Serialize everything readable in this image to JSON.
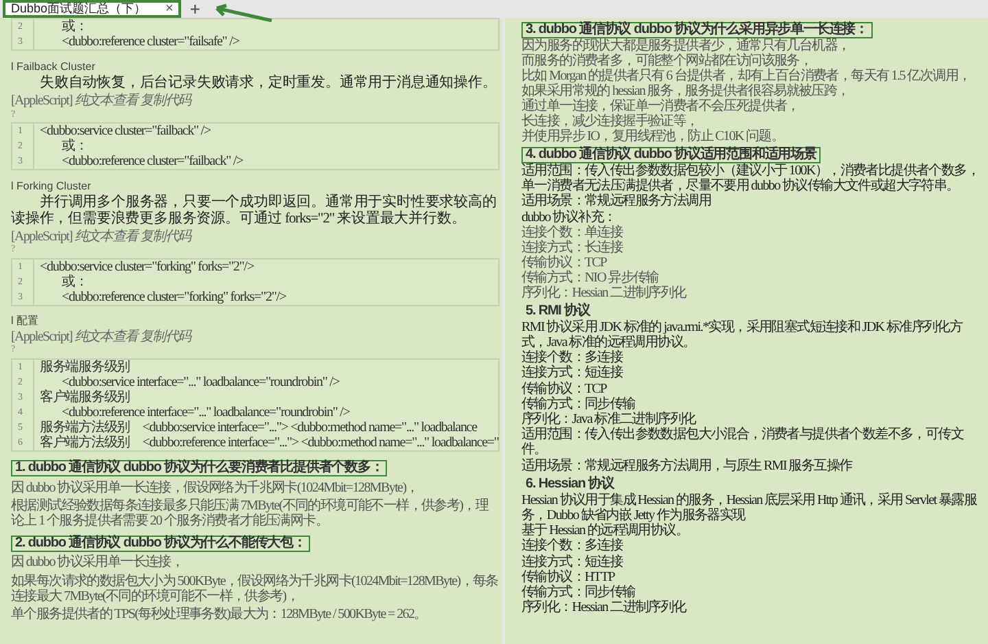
{
  "tab_bar": {
    "tab": {
      "title": "Dubbo面试题汇总（下）",
      "close": "×",
      "selected": true
    },
    "new_tab": "+"
  },
  "left_page": {
    "blocks": [
      {
        "kind": "code",
        "lines": [
          {
            "number": "2",
            "text": "或：",
            "kind": "indent"
          },
          {
            "number": "3",
            "text": "<dubbo:reference cluster=\"failsafe\" />",
            "kind": "indent"
          }
        ]
      },
      {
        "kind": "section",
        "text": "l Failback Cluster"
      },
      {
        "kind": "para",
        "text": "失败自动恢复，后台记录失败请求，定时重发。通常用于消息通知操作。"
      },
      {
        "kind": "note",
        "lang": "[AppleScript]",
        "actions": "纯文本查看 复制代码",
        "marker": "?"
      },
      {
        "kind": "code",
        "lines": [
          {
            "number": "1",
            "text": "<dubbo:service cluster=\"failback\" />",
            "kind": "plain"
          },
          {
            "number": "2",
            "text": "或：",
            "kind": "indent"
          },
          {
            "number": "3",
            "text": "<dubbo:reference cluster=\"failback\" />",
            "kind": "indent"
          }
        ]
      },
      {
        "kind": "section",
        "text": "l Forking Cluster"
      },
      {
        "kind": "para",
        "text": "并行调用多个服务器，只要一个成功即返回。通常用于实时性要求较高的读操作，但需要浪费更多服务资源。可通过 forks=\"2\" 来设置最大并行数。"
      },
      {
        "kind": "note",
        "lang": "[AppleScript]",
        "actions": "纯文本查看 复制代码",
        "marker": "?"
      },
      {
        "kind": "code",
        "lines": [
          {
            "number": "1",
            "text": "<dubbo:service cluster=\"forking\" forks=\"2\"/>",
            "kind": "plain"
          },
          {
            "number": "2",
            "text": "或：",
            "kind": "indent"
          },
          {
            "number": "3",
            "text": "<dubbo:reference cluster=\"forking\" forks=\"2\"/>",
            "kind": "indent"
          }
        ]
      },
      {
        "kind": "section",
        "text": "l 配置"
      },
      {
        "kind": "note",
        "lang": "[AppleScript]",
        "actions": "纯文本查看 复制代码",
        "marker": "?"
      },
      {
        "kind": "code",
        "lines": [
          {
            "number": "1",
            "text": "服务端服务级别",
            "kind": "plain"
          },
          {
            "number": "2",
            "text": "<dubbo:service interface=\"...\" loadbalance=\"roundrobin\" />",
            "kind": "indent"
          },
          {
            "number": "3",
            "text": "客户端服务级别",
            "kind": "plain"
          },
          {
            "number": "4",
            "text": "<dubbo:reference interface=\"...\" loadbalance=\"roundrobin\" />",
            "kind": "indent"
          },
          {
            "number": "5",
            "text": "服务端方法级别　<dubbo:service interface=\"...\"> <dubbo:method name=\"...\" loadbalance",
            "kind": "plain"
          },
          {
            "number": "6",
            "text": "客户端方法级别　<dubbo:reference interface=\"...\"> <dubbo:method name=\"...\" loadbalance=\"",
            "kind": "plain"
          }
        ]
      },
      {
        "kind": "question",
        "text": "1. dubbo 通信协议 dubbo 协议为什么要消费者比提供者个数多：",
        "highlighted": true
      },
      {
        "kind": "small",
        "text": "因 dubbo 协议采用单一长连接，假设网络为千兆网卡(1024Mbit=128MByte)，"
      },
      {
        "kind": "small",
        "text": "根据测试经验数据每条连接最多只能压满 7MByte(不同的环境可能不一样，供参考)，理论上 1 个服务提供者需要 20 个服务消费者才能压满网卡。"
      },
      {
        "kind": "question",
        "text": "2. dubbo 通信协议 dubbo 协议为什么不能传大包：",
        "highlighted": true
      },
      {
        "kind": "small",
        "text": "因 dubbo 协议采用单一长连接，"
      },
      {
        "kind": "small",
        "text": "如果每次请求的数据包大小为 500KByte，假设网络为千兆网卡(1024Mbit=128MByte)，每条连接最大 7MByte(不同的环境可能不一样，供参考)，"
      },
      {
        "kind": "small",
        "text": "单个服务提供者的 TPS(每秒处理事务数)最大为：128MByte / 500KByte = 262。"
      }
    ]
  },
  "right_page": {
    "blocks": [
      {
        "kind": "question",
        "text": "3. dubbo 通信协议 dubbo 协议为什么采用异步单一长连接：",
        "highlighted": true
      },
      {
        "kind": "small",
        "text": "因为服务的现状大都是服务提供者少，通常只有几台机器，"
      },
      {
        "kind": "small",
        "text": "而服务的消费者多，可能整个网站都在访问该服务，"
      },
      {
        "kind": "small",
        "text": "比如 Morgan 的提供者只有 6 台提供者，却有上百台消费者，每天有 1.5 亿次调用，"
      },
      {
        "kind": "small",
        "text": "如果采用常规的 hessian 服务，服务提供者很容易就被压跨，"
      },
      {
        "kind": "small",
        "text": "通过单一连接，保证单一消费者不会压死提供者，"
      },
      {
        "kind": "small",
        "text": "长连接，减少连接握手验证等，"
      },
      {
        "kind": "small",
        "text": "并使用异步 IO，复用线程池，防止 C10K 问题。"
      },
      {
        "kind": "question",
        "text": "4. dubbo 通信协议 dubbo 协议适用范围和适用场景",
        "highlighted": true
      },
      {
        "kind": "body",
        "text": "适用范围：传入传出参数数据包较小（建议小于 100K），消费者比提供者个数多，单一消费者无法压满提供者，尽量不要用 dubbo 协议传输大文件或超大字符串。"
      },
      {
        "kind": "body",
        "text": "适用场景：常规远程服务方法调用"
      },
      {
        "kind": "body",
        "text": "dubbo 协议补充："
      },
      {
        "kind": "small",
        "text": "连接个数：单连接"
      },
      {
        "kind": "small",
        "text": "连接方式：长连接"
      },
      {
        "kind": "small",
        "text": "传输协议：TCP"
      },
      {
        "kind": "small",
        "text": "传输方式：NIO 异步传输"
      },
      {
        "kind": "small",
        "text": "序列化：Hessian 二进制序列化"
      },
      {
        "kind": "question",
        "text": "5. RMI 协议",
        "highlighted": false
      },
      {
        "kind": "body",
        "text": "RMI 协议采用 JDK 标准的 java.rmi.*实现，采用阻塞式短连接和 JDK 标准序列化方式，Java 标准的远程调用协议。"
      },
      {
        "kind": "body",
        "text": "连接个数：多连接"
      },
      {
        "kind": "body",
        "text": "连接方式：短连接"
      },
      {
        "kind": "body",
        "text": "传输协议：TCP"
      },
      {
        "kind": "body",
        "text": "传输方式：同步传输"
      },
      {
        "kind": "body",
        "text": "序列化：Java 标准二进制序列化"
      },
      {
        "kind": "body",
        "text": "适用范围：传入传出参数数据包大小混合，消费者与提供者个数差不多，可传文件。"
      },
      {
        "kind": "body",
        "text": "适用场景：常规远程服务方法调用，与原生 RMI 服务互操作"
      },
      {
        "kind": "question",
        "text": "6. Hessian 协议",
        "highlighted": false
      },
      {
        "kind": "body",
        "text": "Hessian 协议用于集成 Hessian 的服务，Hessian 底层采用 Http 通讯，采用 Servlet 暴露服务，Dubbo 缺省内嵌 Jetty 作为服务器实现"
      },
      {
        "kind": "body",
        "text": "基于 Hessian 的远程调用协议。"
      },
      {
        "kind": "body",
        "text": "连接个数：多连接"
      },
      {
        "kind": "body",
        "text": "连接方式：短连接"
      },
      {
        "kind": "body",
        "text": "传输协议：HTTP"
      },
      {
        "kind": "body",
        "text": "传输方式：同步传输"
      },
      {
        "kind": "body",
        "text": "序列化：Hessian 二进制序列化"
      }
    ]
  }
}
